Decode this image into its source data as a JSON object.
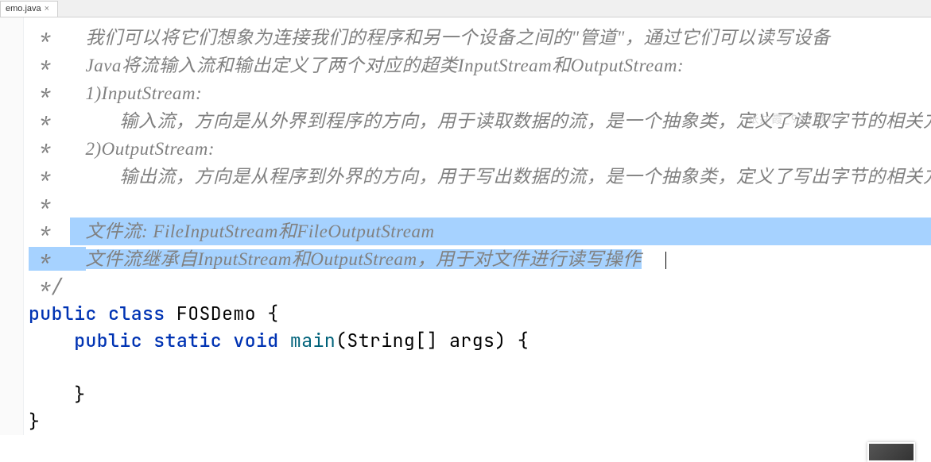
{
  "tab": {
    "name": "emo.java",
    "close": "×"
  },
  "watermark": "张井霞_999784",
  "code": {
    "l1": {
      "star": " *   ",
      "text": "我们可以将它们想象为连接我们的程序和另一个设备之间的\"管道\"，通过它们可以读写设备"
    },
    "l2": {
      "star": " *   ",
      "text": "Java将流输入流和输出定义了两个对应的超类InputStream和OutputStream:"
    },
    "l3": {
      "star": " *   ",
      "text": "1)InputStream:"
    },
    "l4": {
      "star": " *      ",
      "text": "输入流，方向是从外界到程序的方向，用于读取数据的流，是一个抽象类，定义了读取字节的相关方法"
    },
    "l5": {
      "star": " *   ",
      "text": "2)OutputStream:"
    },
    "l6": {
      "star": " *      ",
      "text": "输出流，方向是从程序到外界的方向，用于写出数据的流，是一个抽象类，定义了写出字节的相关方法"
    },
    "l7": {
      "star": " *",
      "text": ""
    },
    "l8": {
      "star": " *   ",
      "text": "文件流: FileInputStream和FileOutputStream"
    },
    "l9": {
      "star": " *   ",
      "text": "文件流继承自InputStream和OutputStream，用于对文件进行读写操作"
    },
    "l10": {
      "star": " */",
      "text": ""
    },
    "l11": {
      "kw1": "public class ",
      "cls": "FOSDemo ",
      "brace": "{"
    },
    "l12": {
      "indent": "    ",
      "kw1": "public static ",
      "kw2": "void ",
      "method": "main",
      "params": "(String[] args) {"
    },
    "l13": {
      "text": ""
    },
    "l14": {
      "indent": "    ",
      "brace": "}"
    },
    "l15": {
      "brace": "}"
    }
  }
}
